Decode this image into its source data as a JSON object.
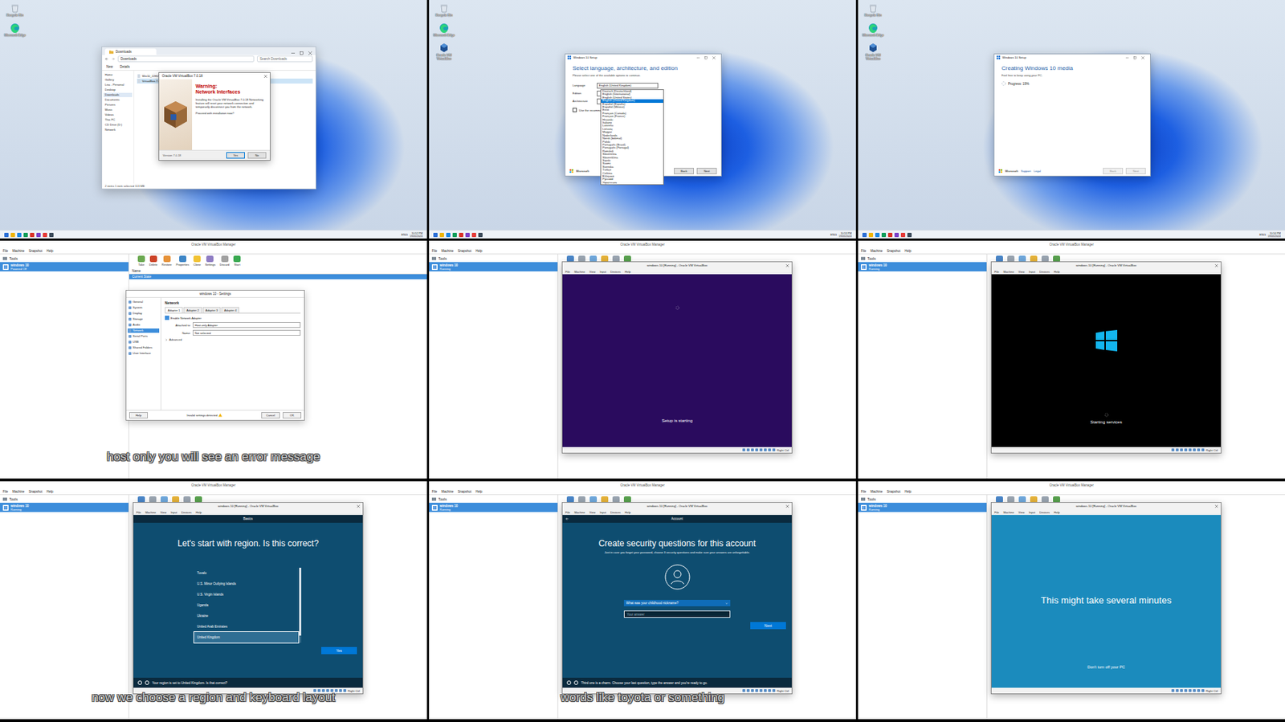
{
  "frames": [
    {
      "kind": "desktop",
      "icons": [
        {
          "label": "Recycle Bin",
          "kind": "recycle"
        },
        {
          "label": "Microsoft Edge",
          "kind": "edge"
        }
      ],
      "window": {
        "kind": "explorer",
        "title": "Downloads",
        "address": "Downloads",
        "search": "Search Downloads",
        "toolbar": [
          "New",
          "Details"
        ],
        "sidebar": [
          {
            "label": "Home",
            "selected": false
          },
          {
            "label": "Gallery",
            "selected": false
          },
          {
            "label": "Lisa - Personal",
            "selected": false
          },
          {
            "label": "Desktop",
            "selected": false
          },
          {
            "label": "Downloads",
            "selected": true
          },
          {
            "label": "Documents",
            "selected": false
          },
          {
            "label": "Pictures",
            "selected": false
          },
          {
            "label": "Music",
            "selected": false
          },
          {
            "label": "Videos",
            "selected": false
          },
          {
            "label": "This PC",
            "selected": false
          },
          {
            "label": "CD Drive (D:)",
            "selected": false
          },
          {
            "label": "Network",
            "selected": false
          }
        ],
        "files": [
          {
            "label": "Win10_22H2_English_x64",
            "selected": false
          },
          {
            "label": "VirtualBox-7.0.18",
            "selected": true
          }
        ],
        "status": "2 items   1 item selected  113 MB",
        "dialog": {
          "title": "Oracle VM VirtualBox 7.0.18",
          "warning": "Warning:",
          "heading": "Network Interfaces",
          "body": "Installing the Oracle VM VirtualBox 7.0.18 Networking feature will reset your network connection and temporarily disconnect you from the network.",
          "question": "Proceed with installation now?",
          "version": "Version 7.0.18",
          "buttons": [
            {
              "label": "Yes",
              "selected": true
            },
            {
              "label": "No",
              "selected": false
            }
          ]
        }
      },
      "taskbar": {
        "lang": "ENG",
        "time": "10:52 PM",
        "date": "19/05/2024"
      }
    },
    {
      "kind": "desktop",
      "icons": [
        {
          "label": "Recycle Bin",
          "kind": "recycle"
        },
        {
          "label": "Microsoft Edge",
          "kind": "edge"
        },
        {
          "label": "Oracle VM VirtualBox",
          "kind": "vbox"
        }
      ],
      "window": {
        "kind": "setup-select",
        "title": "Windows 10 Setup",
        "heading": "Select language, architecture, and edition",
        "sub": "Please select one of the available options to continue.",
        "fields": [
          {
            "label": "Language",
            "value": "English (United Kingdom)"
          },
          {
            "label": "Edition",
            "value": ""
          },
          {
            "label": "Architecture",
            "value": ""
          }
        ],
        "recommended": {
          "label": "Use the recommended options for this PC",
          "checked": false
        },
        "options": [
          {
            "label": "Deutsch (Deutschland)",
            "selected": false
          },
          {
            "label": "English (International)",
            "selected": false
          },
          {
            "label": "English (United States)",
            "selected": false
          },
          {
            "label": "English (United Kingdom)",
            "selected": true
          },
          {
            "label": "Español (España)",
            "selected": false
          },
          {
            "label": "Español (México)",
            "selected": false
          },
          {
            "label": "Eesti",
            "selected": false
          },
          {
            "label": "Français (Canada)",
            "selected": false
          },
          {
            "label": "Français (France)",
            "selected": false
          },
          {
            "label": "Hrvatski",
            "selected": false
          },
          {
            "label": "Italiano",
            "selected": false
          },
          {
            "label": "Latviešu",
            "selected": false
          },
          {
            "label": "Lietuvių",
            "selected": false
          },
          {
            "label": "Magyar",
            "selected": false
          },
          {
            "label": "Nederlands",
            "selected": false
          },
          {
            "label": "Norsk (bokmål)",
            "selected": false
          },
          {
            "label": "Polski",
            "selected": false
          },
          {
            "label": "Português (Brasil)",
            "selected": false
          },
          {
            "label": "Português (Portugal)",
            "selected": false
          },
          {
            "label": "Română",
            "selected": false
          },
          {
            "label": "Slovenčina",
            "selected": false
          },
          {
            "label": "Slovenščina",
            "selected": false
          },
          {
            "label": "Srpski",
            "selected": false
          },
          {
            "label": "Suomi",
            "selected": false
          },
          {
            "label": "Svenska",
            "selected": false
          },
          {
            "label": "Türkçe",
            "selected": false
          },
          {
            "label": "Čeština",
            "selected": false
          },
          {
            "label": "Ελληνικά",
            "selected": false
          },
          {
            "label": "Русский",
            "selected": false
          },
          {
            "label": "Українська",
            "selected": false
          }
        ],
        "footer": {
          "brand": "Microsoft",
          "links": []
        },
        "buttons": [
          {
            "label": "Back",
            "disabled": false
          },
          {
            "label": "Next",
            "disabled": false
          }
        ]
      },
      "taskbar": {
        "lang": "ENG",
        "time": "10:53 PM",
        "date": "19/05/2024"
      }
    },
    {
      "kind": "desktop",
      "icons": [
        {
          "label": "Recycle Bin",
          "kind": "recycle"
        },
        {
          "label": "Microsoft Edge",
          "kind": "edge"
        },
        {
          "label": "Oracle VM VirtualBox",
          "kind": "vbox"
        }
      ],
      "window": {
        "kind": "setup-progress",
        "title": "Windows 10 Setup",
        "heading": "Creating Windows 10 media",
        "sub": "Feel free to keep using your PC.",
        "progress": "Progress: 19%",
        "footer": {
          "brand": "Microsoft",
          "links": [
            "Support",
            "Legal"
          ]
        },
        "buttons": [
          {
            "label": "Back",
            "disabled": true
          },
          {
            "label": "Next",
            "disabled": true
          }
        ]
      },
      "taskbar": {
        "lang": "ENG",
        "time": "10:54 PM",
        "date": "19/05/2024"
      }
    },
    {
      "kind": "virtualbox",
      "manager": {
        "title": "Oracle VM VirtualBox Manager",
        "menu": [
          "File",
          "Machine",
          "Snapshot",
          "Help"
        ],
        "tools": "Tools",
        "vm": {
          "name": "windows 10",
          "status": "Powered Off"
        },
        "toolbar": [
          "Take",
          "Delete",
          "Restore",
          "Properties",
          "Clone",
          "Settings",
          "Discard",
          "Start"
        ],
        "details": {
          "header": "Name",
          "current": "Current State"
        }
      },
      "overlay": {
        "kind": "settings",
        "title": "windows 10 - Settings",
        "sections": [
          {
            "label": "General",
            "selected": false
          },
          {
            "label": "System",
            "selected": false
          },
          {
            "label": "Display",
            "selected": false
          },
          {
            "label": "Storage",
            "selected": false
          },
          {
            "label": "Audio",
            "selected": false
          },
          {
            "label": "Network",
            "selected": true
          },
          {
            "label": "Serial Ports",
            "selected": false
          },
          {
            "label": "USB",
            "selected": false
          },
          {
            "label": "Shared Folders",
            "selected": false
          },
          {
            "label": "User Interface",
            "selected": false
          }
        ],
        "heading": "Network",
        "tabs": [
          {
            "label": "Adapter 1",
            "selected": true
          },
          {
            "label": "Adapter 2",
            "selected": false
          },
          {
            "label": "Adapter 3",
            "selected": false
          },
          {
            "label": "Adapter 4",
            "selected": false
          }
        ],
        "enable": {
          "label": "Enable Network Adapter",
          "checked": true
        },
        "fields": [
          {
            "label": "Attached to:",
            "value": "Host-only Adapter"
          },
          {
            "label": "Name:",
            "value": "Not selected"
          }
        ],
        "advanced": "Advanced",
        "warning": "Invalid settings detected",
        "buttons": [
          "Help",
          "Cancel",
          "OK"
        ]
      },
      "subtitle": "host only you will see an error message"
    },
    {
      "kind": "virtualbox",
      "manager": {
        "title": "Oracle VM VirtualBox Manager",
        "menu": [
          "File",
          "Machine",
          "Snapshot",
          "Help"
        ],
        "tools": "Tools",
        "vm": {
          "name": "windows 10",
          "status": "Running"
        },
        "toolbar": [],
        "details": null
      },
      "overlay": {
        "kind": "vm",
        "title": "windows 10 [Running] - Oracle VM VirtualBox",
        "menu": [
          "File",
          "Machine",
          "View",
          "Input",
          "Devices",
          "Help"
        ],
        "hostKey": "Right Ctrl",
        "screen": {
          "kind": "setup-starting",
          "text": "Setup is starting"
        }
      },
      "subtitle": ""
    },
    {
      "kind": "virtualbox",
      "manager": {
        "title": "Oracle VM VirtualBox Manager",
        "menu": [
          "File",
          "Machine",
          "Snapshot",
          "Help"
        ],
        "tools": "Tools",
        "vm": {
          "name": "windows 10",
          "status": "Running"
        },
        "toolbar": [],
        "details": null
      },
      "overlay": {
        "kind": "vm",
        "title": "windows 10 [Running] - Oracle VM VirtualBox",
        "menu": [
          "File",
          "Machine",
          "View",
          "Input",
          "Devices",
          "Help"
        ],
        "hostKey": "Right Ctrl",
        "screen": {
          "kind": "boot",
          "text": "Starting services"
        }
      },
      "subtitle": ""
    },
    {
      "kind": "virtualbox",
      "manager": {
        "title": "Oracle VM VirtualBox Manager",
        "menu": [
          "File",
          "Machine",
          "Snapshot",
          "Help"
        ],
        "tools": "Tools",
        "vm": {
          "name": "windows 10",
          "status": "Running"
        },
        "toolbar": [],
        "details": null
      },
      "overlay": {
        "kind": "vm",
        "title": "windows 10 [Running] - Oracle VM VirtualBox",
        "menu": [
          "File",
          "Machine",
          "View",
          "Input",
          "Devices",
          "Help"
        ],
        "hostKey": "Right Ctrl",
        "screen": {
          "kind": "region",
          "topbar": "Basics",
          "heading": "Let's start with region. Is this correct?",
          "items": [
            {
              "label": "Tuvalu",
              "selected": false
            },
            {
              "label": "U.S. Minor Outlying Islands",
              "selected": false
            },
            {
              "label": "U.S. Virgin Islands",
              "selected": false
            },
            {
              "label": "Uganda",
              "selected": false
            },
            {
              "label": "Ukraine",
              "selected": false
            },
            {
              "label": "United Arab Emirates",
              "selected": false
            },
            {
              "label": "United Kingdom",
              "selected": true
            }
          ],
          "scroll": {
            "level": 0.9
          },
          "button": "Yes",
          "footer": "Your region is set to United Kingdom. Is that correct?"
        }
      },
      "subtitle": "now we choose a region and keyboard layout"
    },
    {
      "kind": "virtualbox",
      "manager": {
        "title": "Oracle VM VirtualBox Manager",
        "menu": [
          "File",
          "Machine",
          "Snapshot",
          "Help"
        ],
        "tools": "Tools",
        "vm": {
          "name": "windows 10",
          "status": "Running"
        },
        "toolbar": [],
        "details": null
      },
      "overlay": {
        "kind": "vm",
        "title": "windows 10 [Running] - Oracle VM VirtualBox",
        "menu": [
          "File",
          "Machine",
          "View",
          "Input",
          "Devices",
          "Help"
        ],
        "hostKey": "Right Ctrl",
        "screen": {
          "kind": "security",
          "topbar": "Account",
          "heading": "Create security questions for this account",
          "sub": "Just in case you forget your password, choose 3 security questions and make sure your answers are unforgettable.",
          "question": "What was your childhood nickname?",
          "placeholder": "Your answer",
          "button": "Next",
          "footer": "Third one is a charm. Choose your last question, type the answer and you're ready to go."
        }
      },
      "subtitle": "words like toyota or something"
    },
    {
      "kind": "virtualbox",
      "manager": {
        "title": "Oracle VM VirtualBox Manager",
        "menu": [
          "File",
          "Machine",
          "Snapshot",
          "Help"
        ],
        "tools": "Tools",
        "vm": {
          "name": "windows 10",
          "status": "Running"
        },
        "toolbar": [],
        "details": null
      },
      "overlay": {
        "kind": "vm",
        "title": "windows 10 [Running] - Oracle VM VirtualBox",
        "menu": [
          "File",
          "Machine",
          "View",
          "Input",
          "Devices",
          "Help"
        ],
        "hostKey": "Right Ctrl",
        "screen": {
          "kind": "wait",
          "heading": "This might take several minutes",
          "sub": "Don't turn off your PC"
        }
      },
      "subtitle": ""
    }
  ]
}
